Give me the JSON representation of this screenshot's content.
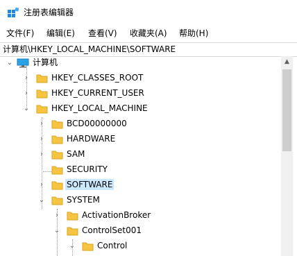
{
  "window": {
    "title": "注册表编辑器"
  },
  "menu": [
    "文件(F)",
    "编辑(E)",
    "查看(V)",
    "收藏夹(A)",
    "帮助(H)"
  ],
  "address": "计算机\\HKEY_LOCAL_MACHINE\\SOFTWARE",
  "tree": {
    "root": "计算机",
    "hkcr": "HKEY_CLASSES_ROOT",
    "hkcu": "HKEY_CURRENT_USER",
    "hklm": "HKEY_LOCAL_MACHINE",
    "bcd": "BCD00000000",
    "hardware": "HARDWARE",
    "sam": "SAM",
    "security": "SECURITY",
    "software": "SOFTWARE",
    "system": "SYSTEM",
    "activation": "ActivationBroker",
    "controlset": "ControlSet001",
    "control": "Control"
  },
  "colors": {
    "selection": "#cce8ff",
    "folder": "#f5c542",
    "accent": "#1e88e5"
  },
  "icons": {
    "expand": "chevron-right-icon",
    "collapse": "chevron-down-icon",
    "folder": "folder-icon",
    "computer": "computer-icon"
  }
}
